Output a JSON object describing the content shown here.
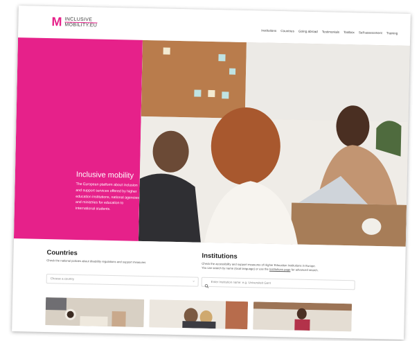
{
  "logo": {
    "line1": "INCLUSIVE",
    "line2": "MOBILITY.EU"
  },
  "nav": [
    "Institutions",
    "Countries",
    "Going abroad",
    "Testimonials",
    "Toolbox",
    "Self-assessment",
    "Training"
  ],
  "hero": {
    "title": "Inclusive mobility",
    "description": "The European platform about inclusion and support services offered by higher education institutions, national agencies and ministries for education to international students."
  },
  "countries": {
    "heading": "Countries",
    "text": "Check the national policies about disability regulations and support measures",
    "select_placeholder": "Choose a country"
  },
  "institutions": {
    "heading": "Institutions",
    "text_1": "Check the accessibility and support measures of Higher Education Institutions in Europe.",
    "text_2a": "You can search by name (local language) or use the",
    "text_2_link": "Institutions page",
    "text_2b": "for advanced search.",
    "search_placeholder": "Enter Institution name: e.g. Universiteit Gent"
  },
  "colors": {
    "brand": "#e6218a"
  }
}
